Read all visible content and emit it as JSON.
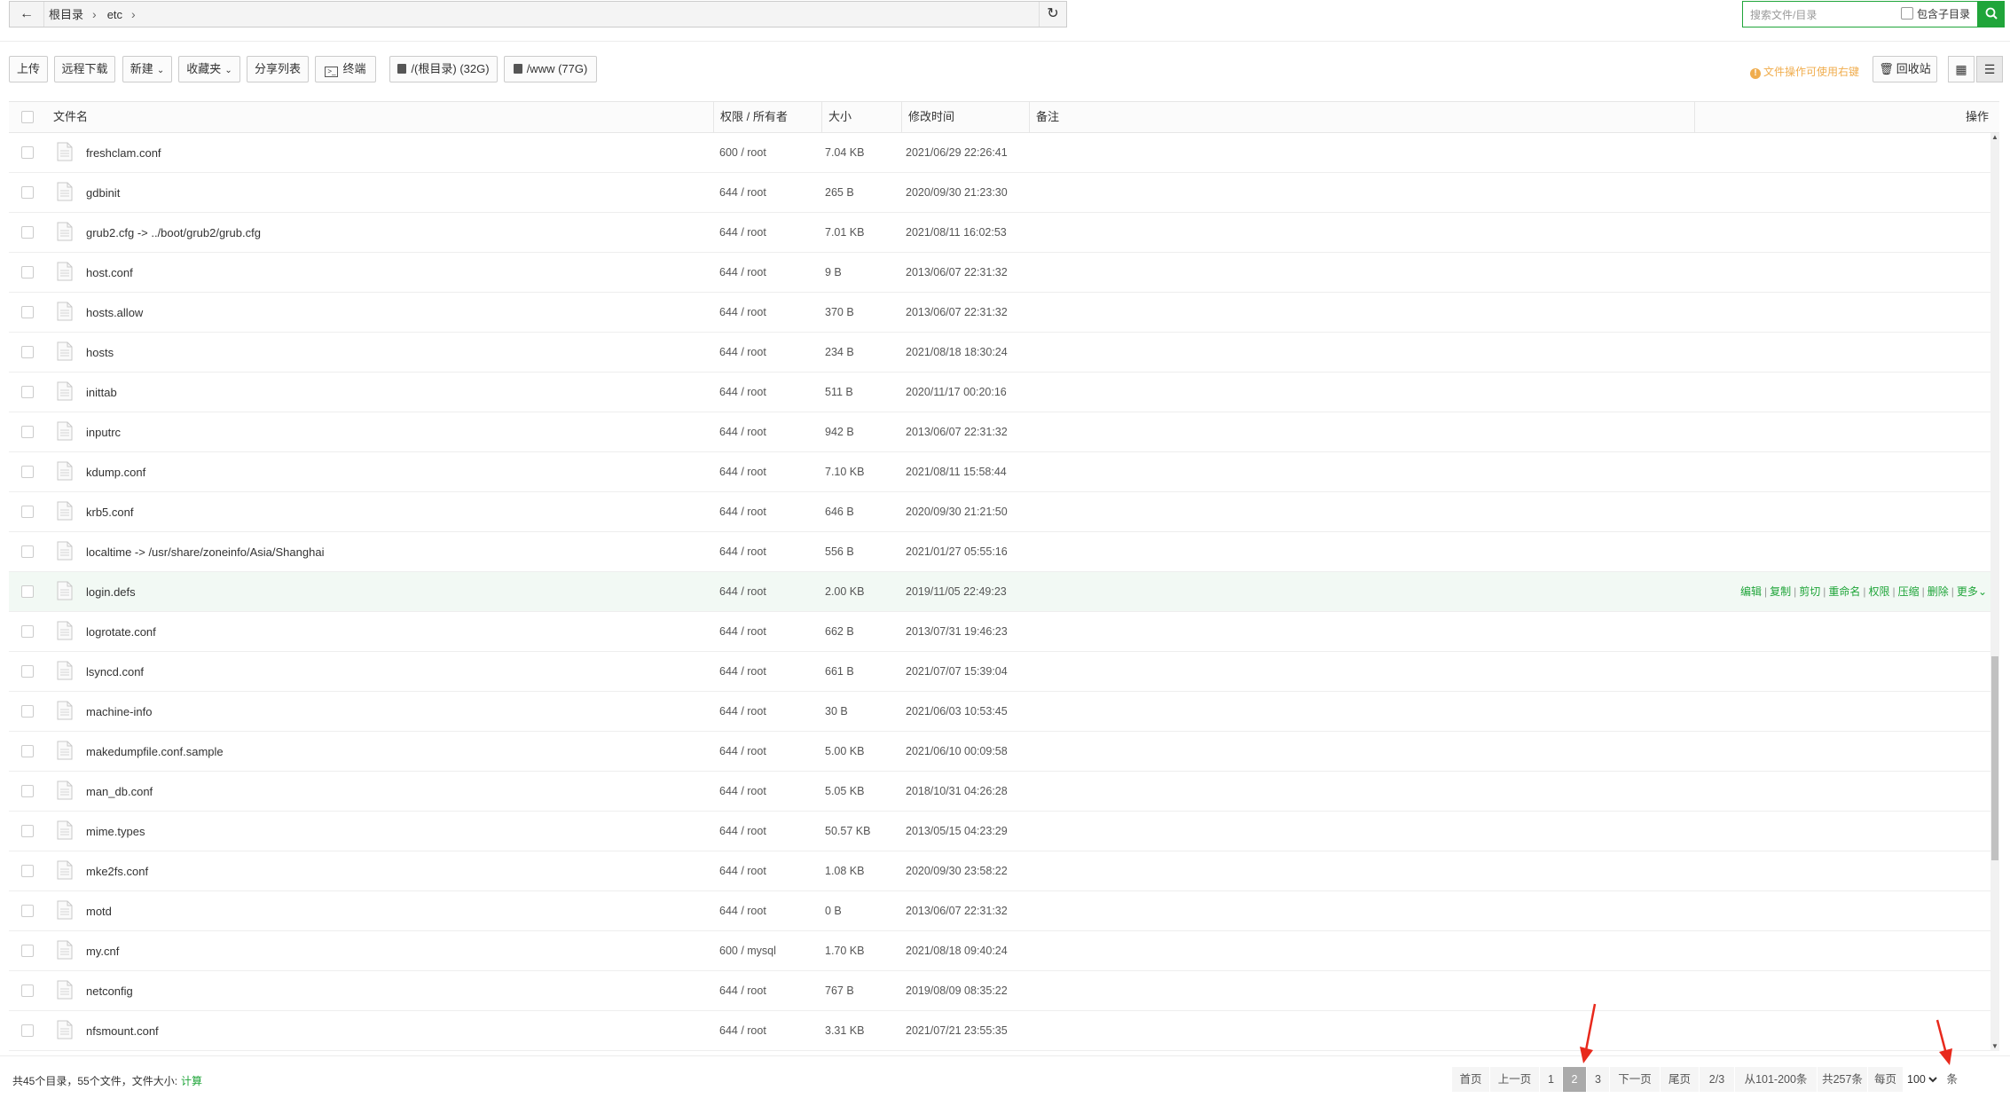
{
  "path": {
    "back_icon": "arrow-left-icon",
    "crumbs": [
      "根目录",
      "etc"
    ],
    "refresh_icon": "refresh-icon"
  },
  "search": {
    "placeholder": "搜索文件/目录",
    "value": "",
    "subdir_label": "包含子目录",
    "subdir_checked": false,
    "search_icon": "search-icon"
  },
  "toolbar": {
    "upload": "上传",
    "remote_download": "远程下载",
    "new": "新建",
    "favorites": "收藏夹",
    "share_list": "分享列表",
    "terminal": "终端",
    "disk_root": "/(根目录) (32G)",
    "disk_www": "/www (77G)",
    "hint": "文件操作可使用右键",
    "recycle": "回收站",
    "view_icons": [
      "grid-icon",
      "list-icon"
    ]
  },
  "table": {
    "headers": {
      "name": "文件名",
      "perm": "权限 / 所有者",
      "size": "大小",
      "mtime": "修改时间",
      "note": "备注",
      "ops": "操作"
    },
    "rows": [
      {
        "name": "freshclam.conf",
        "perm": "600 / root",
        "size": "7.04 KB",
        "mtime": "2021/06/29 22:26:41"
      },
      {
        "name": "gdbinit",
        "perm": "644 / root",
        "size": "265 B",
        "mtime": "2020/09/30 21:23:30"
      },
      {
        "name": "grub2.cfg -> ../boot/grub2/grub.cfg",
        "perm": "644 / root",
        "size": "7.01 KB",
        "mtime": "2021/08/11 16:02:53"
      },
      {
        "name": "host.conf",
        "perm": "644 / root",
        "size": "9 B",
        "mtime": "2013/06/07 22:31:32"
      },
      {
        "name": "hosts.allow",
        "perm": "644 / root",
        "size": "370 B",
        "mtime": "2013/06/07 22:31:32"
      },
      {
        "name": "hosts",
        "perm": "644 / root",
        "size": "234 B",
        "mtime": "2021/08/18 18:30:24"
      },
      {
        "name": "inittab",
        "perm": "644 / root",
        "size": "511 B",
        "mtime": "2020/11/17 00:20:16"
      },
      {
        "name": "inputrc",
        "perm": "644 / root",
        "size": "942 B",
        "mtime": "2013/06/07 22:31:32"
      },
      {
        "name": "kdump.conf",
        "perm": "644 / root",
        "size": "7.10 KB",
        "mtime": "2021/08/11 15:58:44"
      },
      {
        "name": "krb5.conf",
        "perm": "644 / root",
        "size": "646 B",
        "mtime": "2020/09/30 21:21:50"
      },
      {
        "name": "localtime -> /usr/share/zoneinfo/Asia/Shanghai",
        "perm": "644 / root",
        "size": "556 B",
        "mtime": "2021/01/27 05:55:16"
      },
      {
        "name": "login.defs",
        "perm": "644 / root",
        "size": "2.00 KB",
        "mtime": "2019/11/05 22:49:23",
        "hovered": true
      },
      {
        "name": "logrotate.conf",
        "perm": "644 / root",
        "size": "662 B",
        "mtime": "2013/07/31 19:46:23"
      },
      {
        "name": "lsyncd.conf",
        "perm": "644 / root",
        "size": "661 B",
        "mtime": "2021/07/07 15:39:04"
      },
      {
        "name": "machine-info",
        "perm": "644 / root",
        "size": "30 B",
        "mtime": "2021/06/03 10:53:45"
      },
      {
        "name": "makedumpfile.conf.sample",
        "perm": "644 / root",
        "size": "5.00 KB",
        "mtime": "2021/06/10 00:09:58"
      },
      {
        "name": "man_db.conf",
        "perm": "644 / root",
        "size": "5.05 KB",
        "mtime": "2018/10/31 04:26:28"
      },
      {
        "name": "mime.types",
        "perm": "644 / root",
        "size": "50.57 KB",
        "mtime": "2013/05/15 04:23:29"
      },
      {
        "name": "mke2fs.conf",
        "perm": "644 / root",
        "size": "1.08 KB",
        "mtime": "2020/09/30 23:58:22"
      },
      {
        "name": "motd",
        "perm": "644 / root",
        "size": "0 B",
        "mtime": "2013/06/07 22:31:32"
      },
      {
        "name": "my.cnf",
        "perm": "600 / mysql",
        "size": "1.70 KB",
        "mtime": "2021/08/18 09:40:24"
      },
      {
        "name": "netconfig",
        "perm": "644 / root",
        "size": "767 B",
        "mtime": "2019/08/09 08:35:22"
      },
      {
        "name": "nfsmount.conf",
        "perm": "644 / root",
        "size": "3.31 KB",
        "mtime": "2021/07/21 23:55:35"
      }
    ],
    "row_ops": [
      "编辑",
      "复制",
      "剪切",
      "重命名",
      "权限",
      "压缩",
      "删除"
    ],
    "row_ops_more": "更多"
  },
  "footer": {
    "summary": "共45个目录，55个文件，文件大小:",
    "calc": "计算",
    "pager": {
      "first": "首页",
      "prev": "上一页",
      "pages": [
        "1",
        "2",
        "3"
      ],
      "current": "2",
      "next": "下一页",
      "last": "尾页",
      "page_of": "2/3",
      "range": "从101-200条",
      "total": "共257条",
      "per_page_label": "每页",
      "per_page_value": "100",
      "per_page_unit": "条"
    }
  },
  "colors": {
    "accent": "#20a53a",
    "hint": "#f0ad4e",
    "annotation_arrow": "#e8291c"
  }
}
